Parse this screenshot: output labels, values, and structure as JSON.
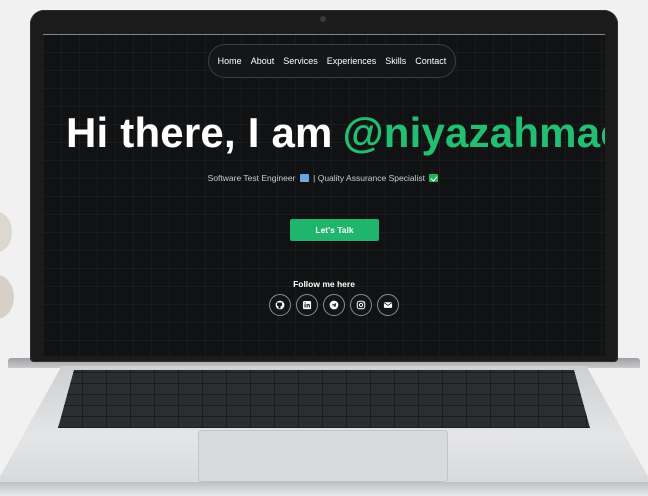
{
  "nav": {
    "items": [
      "Home",
      "About",
      "Services",
      "Experiences",
      "Skills",
      "Contact"
    ]
  },
  "hero": {
    "lead": "Hi there, I am",
    "handle": "@niyazahmac"
  },
  "subtitle": {
    "part1": "Software Test Engineer",
    "part2": "| Quality Assurance Specialist"
  },
  "cta": {
    "label": "Let's Talk"
  },
  "social": {
    "title": "Follow me here",
    "icons": [
      "github-icon",
      "linkedin-icon",
      "telegram-icon",
      "instagram-icon",
      "email-icon"
    ]
  },
  "colors": {
    "accent": "#1fb56d",
    "screen_bg": "#101213",
    "text": "#ffffff"
  }
}
